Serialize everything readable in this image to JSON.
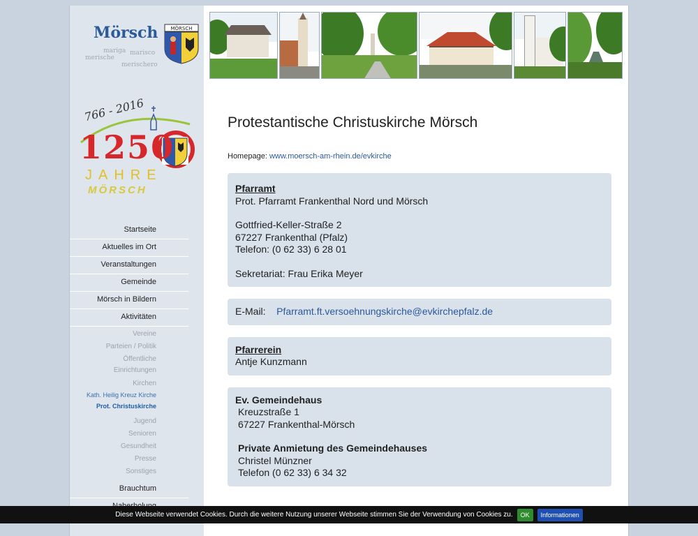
{
  "logo": {
    "title": "Mörsch",
    "coat_label": "MÖRSCH",
    "words": [
      "mariga",
      "merische",
      "marisco",
      "merischero"
    ]
  },
  "anniversary": {
    "years": "766 - 2016",
    "number": "1250",
    "jahre": "JAHRE",
    "ort": "MÖRSCH"
  },
  "nav": {
    "items": [
      "Startseite",
      "Aktuelles im Ort",
      "Veranstaltungen",
      "Gemeinde",
      "Mörsch in Bildern",
      "Aktivitäten"
    ],
    "sub": [
      "Vereine",
      "Parteien / Politik",
      "Öffentliche",
      "Einrichtungen",
      "Kirchen"
    ],
    "kirchen_sub": [
      "Kath. Heilig Kreuz Kirche",
      "Prot. Christuskirche"
    ],
    "sub2": [
      "Jugend",
      "Senioren",
      "Gesundheit",
      "Presse",
      "Sonstiges"
    ],
    "items2": [
      "Brauchtum",
      "Naherholung"
    ]
  },
  "main": {
    "title": "Protestantische Christuskirche Mörsch",
    "homepage_label": "Homepage:",
    "homepage_link": "www.moersch-am-rhein.de/evkirche",
    "pfarramt": {
      "heading": "Pfarramt",
      "name": "Prot. Pfarramt Frankenthal Nord und Mörsch",
      "street": "Gottfried-Keller-Straße 2",
      "city": "67227 Frankenthal (Pfalz)",
      "phone": "Telefon: (0 62 33) 6 28 01",
      "secretary": "Sekretariat: Frau Erika Meyer"
    },
    "email": {
      "label": "E-Mail:",
      "address": "Pfarramt.ft.versoehnungskirche@evkirchepfalz.de"
    },
    "pfarrerin": {
      "heading": "Pfarrerein",
      "name": "Antje Kunzmann"
    },
    "gemeindehaus": {
      "heading": "Ev. Gemeindehaus",
      "street": "Kreuzstraße 1",
      "city": "67227 Frankenthal-Mörsch",
      "rental_heading": "Private Anmietung des Gemeindehauses",
      "contact": "Christel Münzner",
      "phone": "Telefon (0 62 33) 6 34 32"
    }
  },
  "cookie": {
    "text": "Diese Webseite verwendet Cookies. Durch die weitere Nutzung unserer Webseite stimmen Sie der Verwendung von Cookies zu.",
    "ok": "OK",
    "info": "Informationen"
  },
  "colors": {
    "accent": "#2a5a9a",
    "background": "#c9d3df",
    "box": "#d9e1ea",
    "anniversary_red": "#d6282a"
  }
}
